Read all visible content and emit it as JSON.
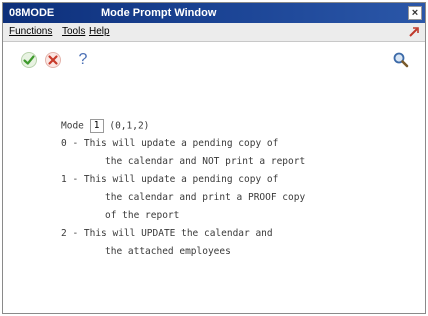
{
  "window": {
    "app_code": "08MODE",
    "title": "Mode Prompt Window",
    "close_label": "×"
  },
  "menu": {
    "functions": "Functions",
    "tools": "Tools",
    "help": "Help"
  },
  "toolbar": {
    "ok_icon": "check-icon",
    "cancel_icon": "cancel-icon",
    "help_label": "?",
    "find_icon": "magnifier-icon"
  },
  "form": {
    "mode_label": "Mode",
    "mode_value": "1",
    "mode_options": "(0,1,2)",
    "lines": [
      "0 - This will update a pending copy of",
      "the calendar and NOT print a report",
      "1 - This will update a pending copy of",
      "the calendar and print a PROOF copy",
      "of the report",
      "2 - This will UPDATE the calendar and",
      "the attached employees"
    ]
  },
  "colors": {
    "titlebar": "#1c4596",
    "ok_green": "#3f9a2e",
    "cancel_red": "#c83a2a"
  }
}
